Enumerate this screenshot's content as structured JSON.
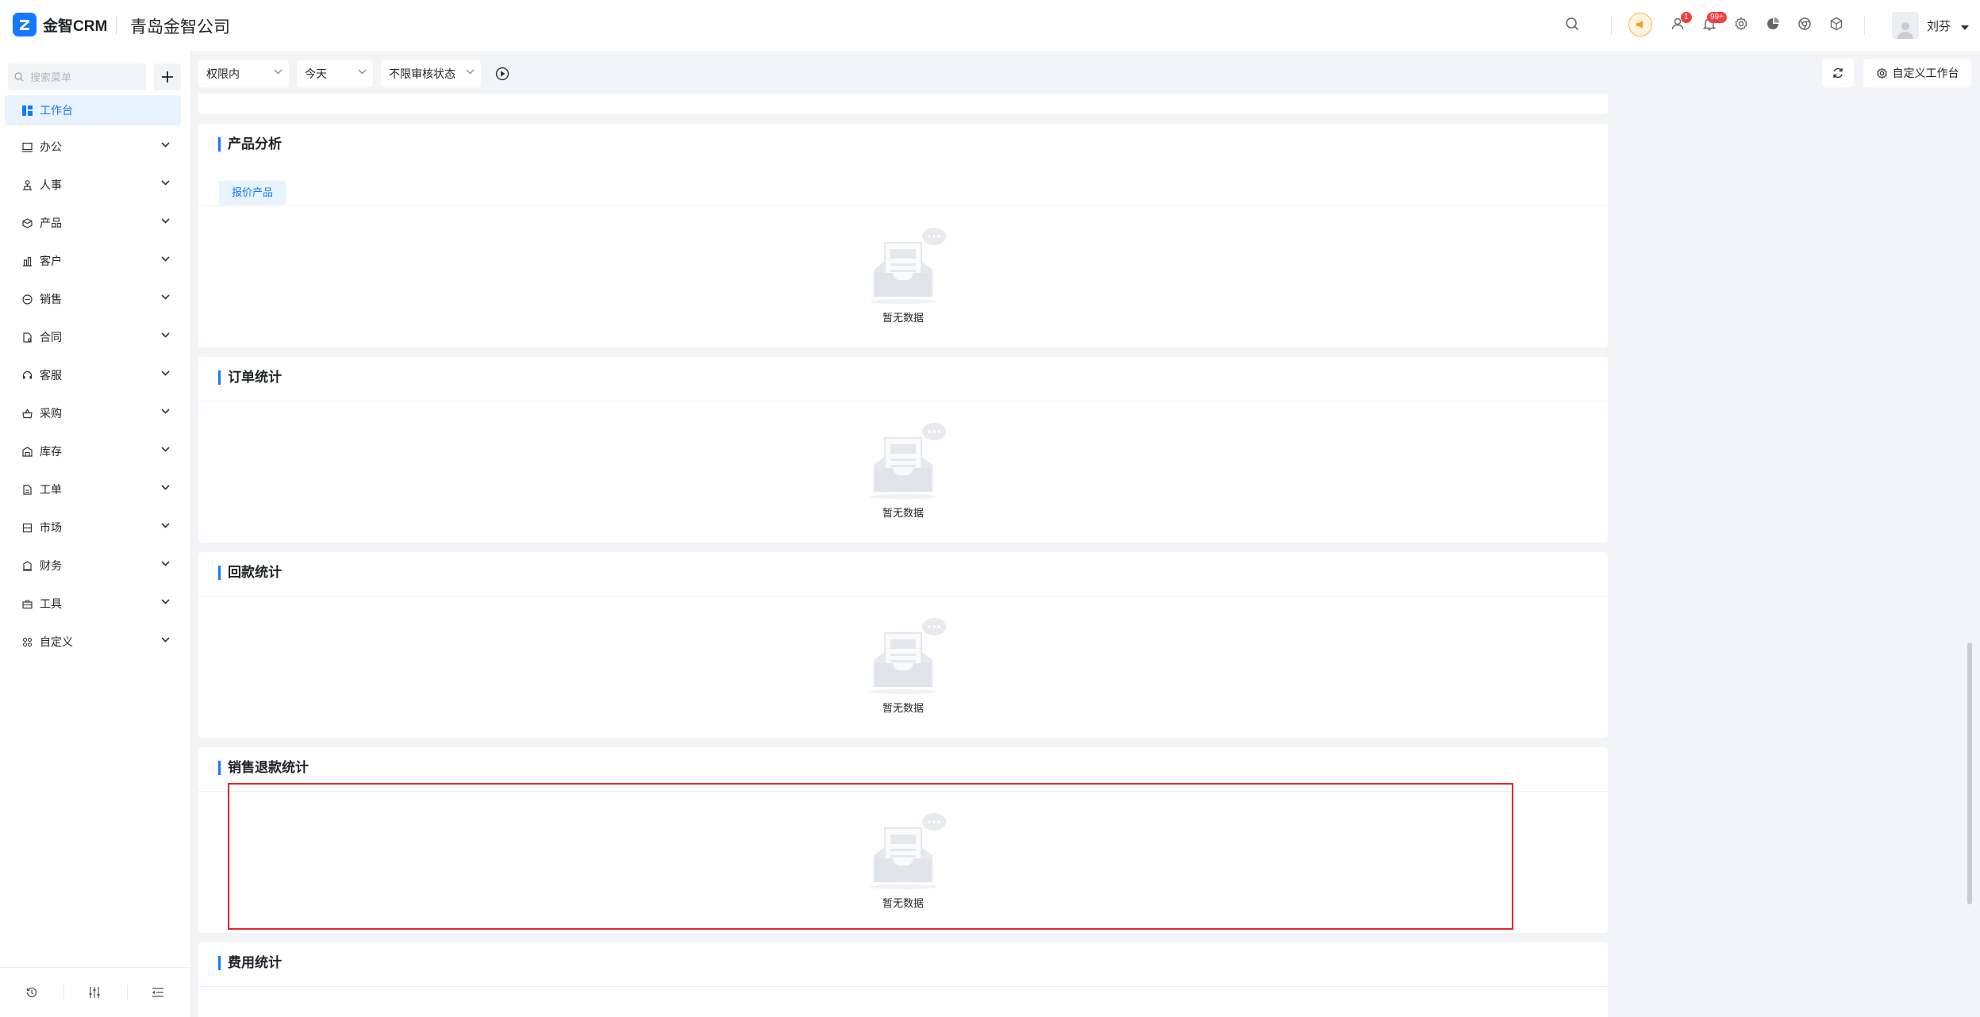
{
  "header": {
    "logo_text": "金智CRM",
    "company": "青岛金智公司",
    "badge_contacts": "1",
    "badge_notifications": "99+",
    "user_name": "刘芬"
  },
  "sidebar": {
    "search_placeholder": "搜索菜单",
    "items": [
      {
        "label": "工作台",
        "icon": "dashboard-icon"
      },
      {
        "label": "办公",
        "icon": "office-icon"
      },
      {
        "label": "人事",
        "icon": "hr-icon"
      },
      {
        "label": "产品",
        "icon": "product-icon"
      },
      {
        "label": "客户",
        "icon": "customer-icon"
      },
      {
        "label": "销售",
        "icon": "sales-icon"
      },
      {
        "label": "合同",
        "icon": "contract-icon"
      },
      {
        "label": "客服",
        "icon": "headset-icon"
      },
      {
        "label": "采购",
        "icon": "purchase-icon"
      },
      {
        "label": "库存",
        "icon": "warehouse-icon"
      },
      {
        "label": "工单",
        "icon": "ticket-icon"
      },
      {
        "label": "市场",
        "icon": "market-icon"
      },
      {
        "label": "财务",
        "icon": "finance-icon"
      },
      {
        "label": "工具",
        "icon": "toolbox-icon"
      },
      {
        "label": "自定义",
        "icon": "grid-icon"
      }
    ]
  },
  "toolbar": {
    "scope_select": "权限内",
    "date_select": "今天",
    "audit_select": "不限审核状态",
    "customize_label": "自定义工作台"
  },
  "panels": {
    "product": {
      "title": "产品分析",
      "tab": "报价产品",
      "empty": "暂无数据"
    },
    "order": {
      "title": "订单统计",
      "empty": "暂无数据"
    },
    "payment": {
      "title": "回款统计",
      "empty": "暂无数据"
    },
    "refund": {
      "title": "销售退款统计",
      "empty": "暂无数据"
    },
    "expense": {
      "title": "费用统计"
    }
  },
  "colors": {
    "accent": "#1677ff",
    "highlight_border": "#e5252a",
    "badge": "#f53f3f"
  }
}
